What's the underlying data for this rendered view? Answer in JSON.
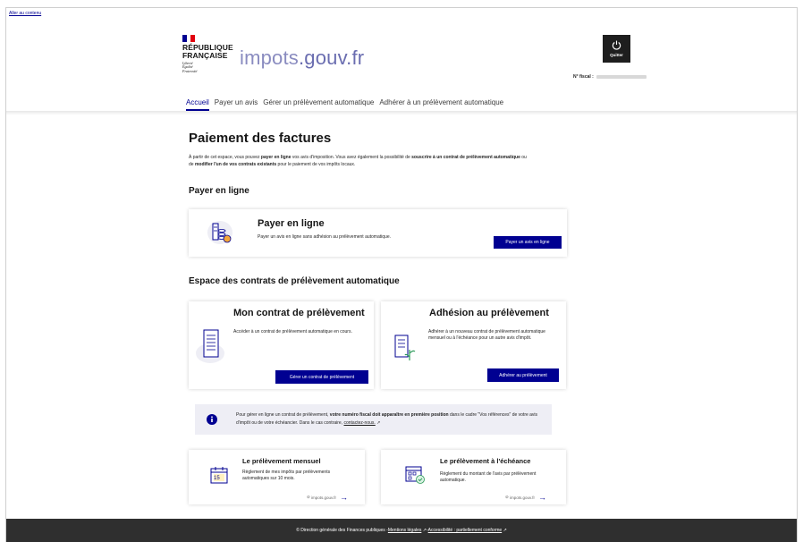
{
  "skip_link": "Aller au contenu",
  "header": {
    "brand_lines": [
      "RÉPUBLIQUE",
      "FRANÇAISE"
    ],
    "devise": [
      "Liberté",
      "Égalité",
      "Fraternité"
    ],
    "site_name_a": "impots",
    "site_name_b": ".gouv.fr",
    "quit_label": "Quitter",
    "fiscal_label": "N° fiscal :"
  },
  "nav": {
    "items": [
      "Accueil",
      "Payer un avis",
      "Gérer un prélèvement automatique",
      "Adhérer à un prélèvement automatique"
    ]
  },
  "page": {
    "title": "Paiement des factures",
    "intro_1": "À partir de cet espace, vous pouvez ",
    "intro_b1": "payer en ligne",
    "intro_2": " vos avis d'imposition. Vous avez également la possibilité de ",
    "intro_b2": "souscrire à un contrat de prélèvement automatique",
    "intro_3": " ou de ",
    "intro_b3": "modifier l'un de vos contrats existants",
    "intro_4": " pour le paiement de vos impôts locaux."
  },
  "pay_section": {
    "heading": "Payer en ligne",
    "card_title": "Payer en ligne",
    "card_text": "Payer un avis en ligne sans adhésion au prélèvement automatique.",
    "button": "Payer un avis en ligne"
  },
  "contracts_section": {
    "heading": "Espace des contrats de prélèvement automatique",
    "contract_title": "Mon contrat de prélèvement",
    "contract_text": "Accéder à un contrat de prélèvement automatique en cours.",
    "contract_button": "Gérer un contrat de prélèvement",
    "adhesion_title": "Adhésion au prélèvement",
    "adhesion_text": "Adhérer à un nouveau contrat de prélèvement automatique mensuel ou à l'échéance pour un autre avis d'impôt.",
    "adhesion_button": "Adhérer au prélèvement"
  },
  "info": {
    "t1": "Pour gérer en ligne un contrat de prélèvement, ",
    "b1": "votre numéro fiscal doit apparaître en première position",
    "t2": " dans le cadre \"Vos références\" de votre avis d'impôt ou de votre échéancier. Dans le cas contraire, ",
    "link": "contactez-nous."
  },
  "tiles": {
    "monthly_title": "Le prélèvement mensuel",
    "monthly_text": "Règlement de mes impôts par prélèvements automatiques sur 10 mois.",
    "monthly_day": "15",
    "due_title": "Le prélèvement à l'échéance",
    "due_text": "Règlement du montant de l'avis par prélèvement automatique.",
    "ext": "impots.gouv.fr"
  },
  "footer": {
    "t1": "© Direction générale des Finances publiques - ",
    "legal": "Mentions légales",
    "sep": " - ",
    "access": "Accessibilité : partiellement conforme"
  },
  "colors": {
    "primary": "#000091",
    "footer_bg": "#2f2f2f",
    "info_bg": "#eeeef5",
    "flag_blue": "#000091",
    "flag_red": "#e1000f"
  }
}
